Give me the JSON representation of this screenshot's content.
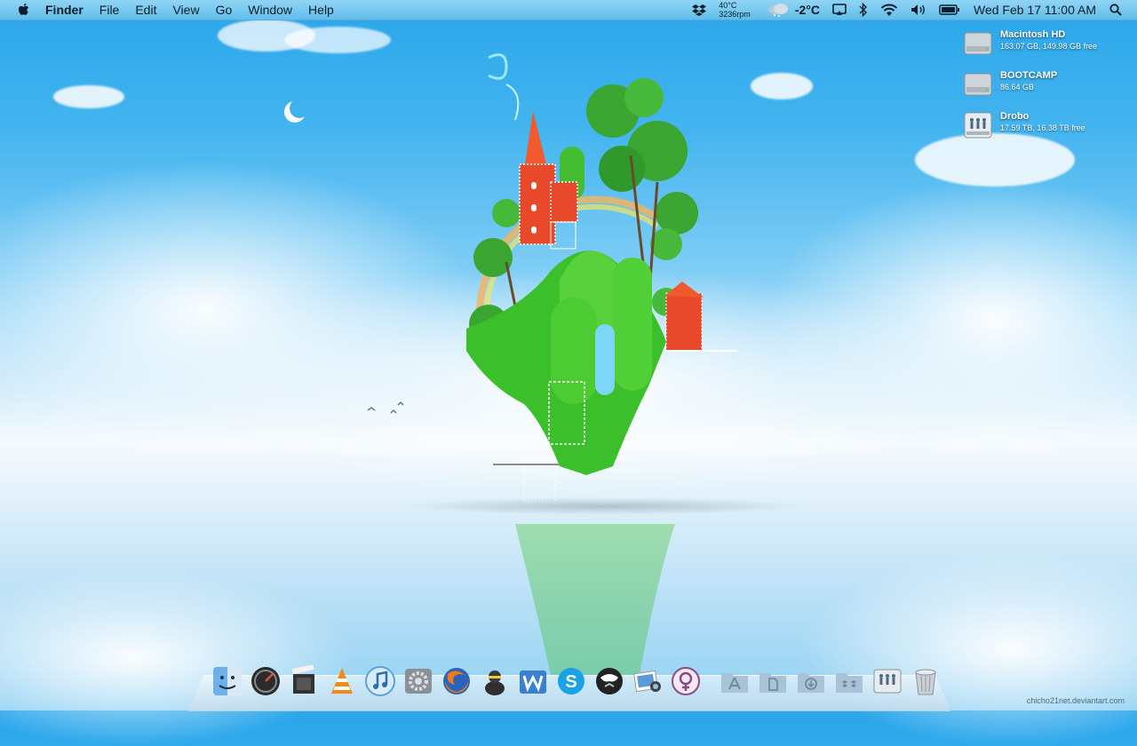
{
  "menubar": {
    "app_name": "Finder",
    "menus": [
      "File",
      "Edit",
      "View",
      "Go",
      "Window",
      "Help"
    ],
    "cpu_temp": "40°C",
    "fan_speed": "3236rpm",
    "weather_temp": "-2°C",
    "clock": "Wed Feb 17  11:00 AM"
  },
  "volumes": [
    {
      "name": "Macintosh HD",
      "info": "163.07 GB, 149.98 GB free",
      "icon": "hard-drive-icon"
    },
    {
      "name": "BOOTCAMP",
      "info": "86.64 GB",
      "icon": "hard-drive-icon"
    },
    {
      "name": "Drobo",
      "info": "17.59 TB, 16.38 TB free",
      "icon": "network-drive-icon"
    }
  ],
  "dock": {
    "apps": [
      "finder-icon",
      "dashboard-icon",
      "final-cut-icon",
      "vlc-icon",
      "itunes-icon",
      "system-preferences-icon",
      "firefox-icon",
      "adium-icon",
      "word-icon",
      "skype-icon",
      "camino-icon",
      "iphoto-icon",
      "gender-app-icon"
    ],
    "folders": [
      "applications-folder-icon",
      "documents-folder-icon",
      "downloads-folder-icon",
      "dropbox-folder-icon",
      "drobo-dock-icon",
      "trash-icon"
    ]
  },
  "watermark": "chicho21net.deviantart.com",
  "colors": {
    "sky": "#2aa6ea",
    "grass": "#3bbf2a",
    "house": "#e8492b"
  }
}
